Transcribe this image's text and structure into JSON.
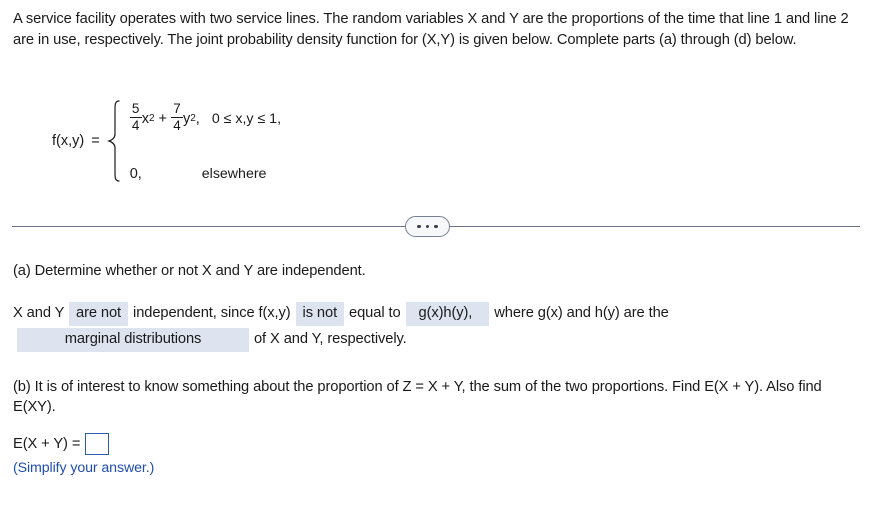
{
  "problem": {
    "statement": "A service facility operates with two service lines. The random variables X and Y are the proportions of the time that line 1 and line 2 are in use, respectively. The joint probability density function for (X,Y) is given below. Complete parts (a) through (d) below."
  },
  "formula": {
    "function_label": "f(x,y)",
    "equals": "=",
    "case1": {
      "frac1_num": "5",
      "frac1_den": "4",
      "var1": "x",
      "exp1": "2",
      "operator": "+",
      "frac2_num": "7",
      "frac2_den": "4",
      "var2": "y",
      "exp2": "2",
      "comma": ",",
      "condition": "0 ≤ x,y ≤ 1,"
    },
    "case2": {
      "value": "0,",
      "condition": "elsewhere"
    }
  },
  "divider": {
    "ellipsis_label": "...",
    "dot_count": 3
  },
  "part_a": {
    "question": "(a) Determine whether or not X and Y are independent.",
    "answer_prefix": "X and Y",
    "blank1": "are not",
    "text1": "independent, since f(x,y)",
    "blank2": "is not",
    "text2": "equal to",
    "blank3": "g(x)h(y),",
    "text3": "where g(x) and h(y) are the",
    "blank4": "marginal distributions",
    "text4": "of X and Y, respectively."
  },
  "part_b": {
    "question": "(b) It is of interest to know something about the proportion of Z = X + Y, the sum of the two proportions. Find E(X + Y). Also find E(XY).",
    "answer_label": "E(X + Y) =",
    "answer_value": "",
    "note": "(Simplify your answer.)"
  },
  "colors": {
    "highlight": "#dde4f0",
    "input_border": "#2b5cb0",
    "note_text": "#1f4fb0",
    "divider": "#6b7189"
  }
}
